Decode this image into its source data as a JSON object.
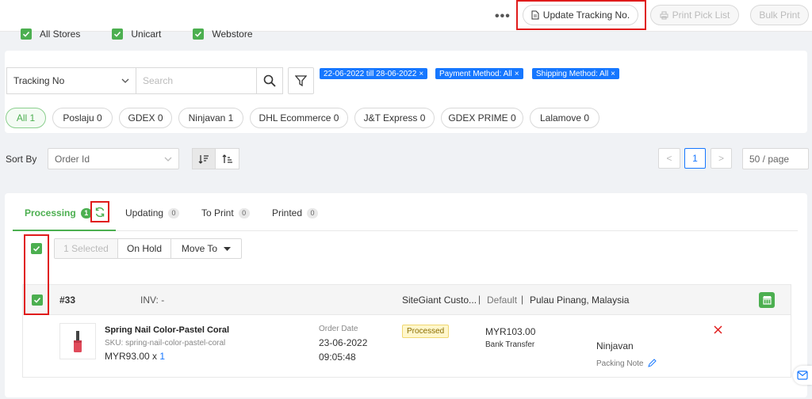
{
  "topbar": {
    "stores": [
      "All Stores",
      "Unicart",
      "Webstore"
    ],
    "more_label": "•••",
    "update_tracking_label": "Update Tracking No.",
    "print_pick_list_label": "Print Pick List",
    "bulk_print_label": "Bulk Print"
  },
  "filters": {
    "search_field_value": "Tracking No",
    "search_placeholder": "Search",
    "tags": [
      "22-06-2022 till 28-06-2022",
      "Payment Method: All",
      "Shipping Method: All"
    ],
    "couriers": [
      {
        "label": "All 1",
        "active": true
      },
      {
        "label": "Poslaju 0"
      },
      {
        "label": "GDEX 0"
      },
      {
        "label": "Ninjavan 1"
      },
      {
        "label": "DHL Ecommerce 0"
      },
      {
        "label": "J&T Express 0"
      },
      {
        "label": "GDEX PRIME 0"
      },
      {
        "label": "Lalamove 0"
      }
    ],
    "sort_label": "Sort By",
    "sort_value": "Order Id",
    "page_number": "1",
    "page_size": "50 / page",
    "prev": "<",
    "next": ">"
  },
  "tabs": [
    {
      "label": "Processing",
      "count": "1"
    },
    {
      "label": "Updating",
      "count": "0"
    },
    {
      "label": "To Print",
      "count": "0"
    },
    {
      "label": "Printed",
      "count": "0"
    }
  ],
  "actions": {
    "selected": "1 Selected",
    "on_hold": "On Hold",
    "move_to": "Move To"
  },
  "order": {
    "id": "#33",
    "invoice": "INV: -",
    "customer": "SiteGiant Custo...",
    "separator": "|",
    "store_type": "Default",
    "location": "Pulau Pinang, Malaysia",
    "product_name": "Spring Nail Color-Pastel Coral",
    "sku": "SKU: spring-nail-color-pastel-coral",
    "price_qty_prefix": "MYR93.00 x ",
    "qty": "1",
    "order_date_label": "Order Date",
    "order_date": "23-06-2022",
    "order_time": "09:05:48",
    "status": "Processed",
    "total": "MYR103.00",
    "payment": "Bank Transfer",
    "courier": "Ninjavan",
    "packing_note": "Packing Note"
  },
  "colors": {
    "accent_green": "#4caf50",
    "tag_blue": "#1677ff",
    "highlight_red": "#e01b1b",
    "status_yellow": "#fff7cc"
  }
}
